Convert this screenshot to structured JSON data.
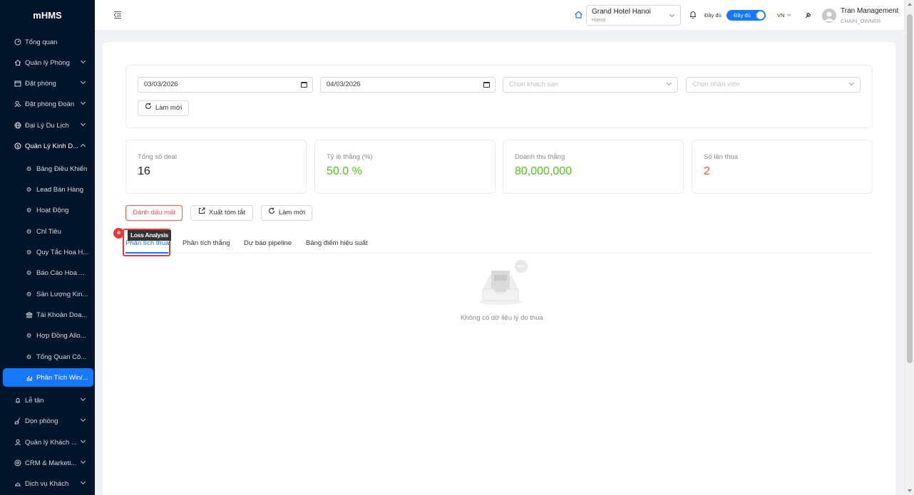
{
  "app": {
    "logo": "mHMS"
  },
  "sidebar": {
    "items": [
      {
        "label": "Tổng quan",
        "icon": "dashboard-icon"
      },
      {
        "label": "Quản lý Phòng",
        "icon": "home-icon"
      },
      {
        "label": "Đặt phòng",
        "icon": "calendar-icon"
      },
      {
        "label": "Đặt phòng Đoàn",
        "icon": "team-icon"
      },
      {
        "label": "Đại Lý Du Lịch",
        "icon": "globe-icon"
      },
      {
        "label": "Quản Lý Kinh D...",
        "icon": "dollar-icon"
      },
      {
        "label": "Lễ tân",
        "icon": "bell-icon"
      },
      {
        "label": "Dọn phòng",
        "icon": "clean-icon"
      },
      {
        "label": "Quản lý Khách ...",
        "icon": "user-icon"
      },
      {
        "label": "CRM & Marketi...",
        "icon": "crm-icon"
      },
      {
        "label": "Dịch vụ Khách",
        "icon": "service-icon"
      }
    ],
    "subitems": [
      {
        "label": "Bảng Điều Khiển"
      },
      {
        "label": "Lead Bán Hàng"
      },
      {
        "label": "Hoạt Động"
      },
      {
        "label": "Chỉ Tiêu"
      },
      {
        "label": "Quy Tắc Hoa H..."
      },
      {
        "label": "Báo Cáo Hoa ..."
      },
      {
        "label": "Sản Lượng Kin..."
      },
      {
        "label": "Tài Khoản Doa..."
      },
      {
        "label": "Hợp Đồng Allo..."
      },
      {
        "label": "Tổng Quan Cô..."
      },
      {
        "label": "Phân Tích Win/..."
      }
    ]
  },
  "header": {
    "hotel_name": "Grand Hotel Hanoi",
    "hotel_city": "Hanoi",
    "mode_label": "Đầy đủ",
    "toggle_label": "Đầy đủ",
    "language": "VN",
    "user_name": "Tran Management",
    "user_role": "CHAIN_OWNER"
  },
  "filters": {
    "date_from": "03/03/2026",
    "date_to": "04/03/2026",
    "hotel_placeholder": "Chọn khách sạn",
    "staff_placeholder": "Chọn nhân viên",
    "refresh_label": "Làm mới"
  },
  "stats": [
    {
      "label": "Tổng số deal",
      "value": "16"
    },
    {
      "label": "Tỷ lệ thắng (%)",
      "value": "50.0 %"
    },
    {
      "label": "Doanh thu thắng",
      "value": "80,000,000"
    },
    {
      "label": "Số lần thua",
      "value": "2"
    }
  ],
  "actions": {
    "mark_lost": "Đánh dấu mất",
    "export_summary": "Xuất tóm tắt",
    "refresh": "Làm mới"
  },
  "annotation": {
    "badge": "⊕",
    "tag": "Loss Analysis"
  },
  "tabs": [
    {
      "label": "Phân tích thua"
    },
    {
      "label": "Phân tích thắng"
    },
    {
      "label": "Dự báo pipeline"
    },
    {
      "label": "Bảng điểm hiệu suất"
    }
  ],
  "empty_state": {
    "message": "Không có dữ liệu lý do thua"
  },
  "colors": {
    "primary": "#1677ff",
    "success": "#52c41a",
    "danger": "#ff4d4f",
    "sidebar": "#001529"
  }
}
